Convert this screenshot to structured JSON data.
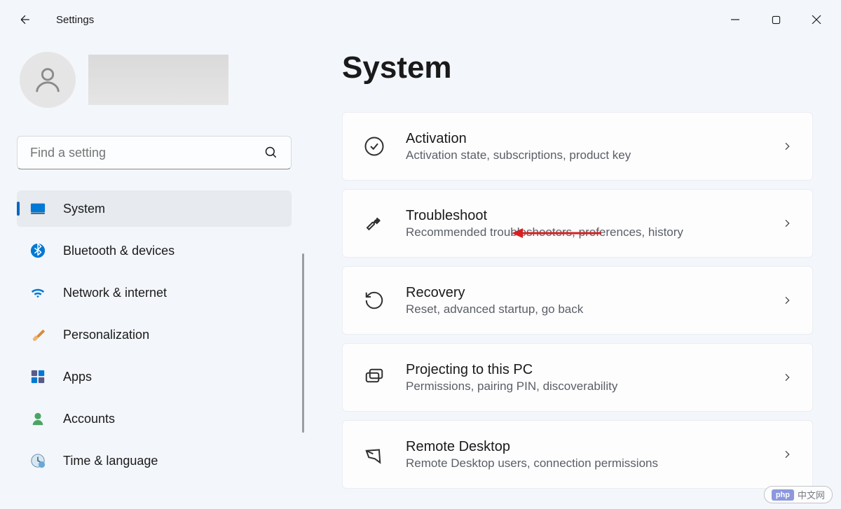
{
  "window": {
    "title": "Settings"
  },
  "user": {
    "name_hidden": true
  },
  "search": {
    "placeholder": "Find a setting"
  },
  "sidebar": {
    "items": [
      {
        "label": "System",
        "icon": "system",
        "active": true
      },
      {
        "label": "Bluetooth & devices",
        "icon": "bluetooth"
      },
      {
        "label": "Network & internet",
        "icon": "wifi"
      },
      {
        "label": "Personalization",
        "icon": "brush"
      },
      {
        "label": "Apps",
        "icon": "apps"
      },
      {
        "label": "Accounts",
        "icon": "accounts"
      },
      {
        "label": "Time & language",
        "icon": "time"
      }
    ]
  },
  "page": {
    "title": "System"
  },
  "cards": [
    {
      "title": "Activation",
      "desc": "Activation state, subscriptions, product key",
      "icon": "activation"
    },
    {
      "title": "Troubleshoot",
      "desc": "Recommended troubleshooters, preferences, history",
      "icon": "troubleshoot"
    },
    {
      "title": "Recovery",
      "desc": "Reset, advanced startup, go back",
      "icon": "recovery"
    },
    {
      "title": "Projecting to this PC",
      "desc": "Permissions, pairing PIN, discoverability",
      "icon": "projecting"
    },
    {
      "title": "Remote Desktop",
      "desc": "Remote Desktop users, connection permissions",
      "icon": "remote"
    }
  ],
  "watermark": {
    "brand": "php",
    "text": "中文网"
  }
}
